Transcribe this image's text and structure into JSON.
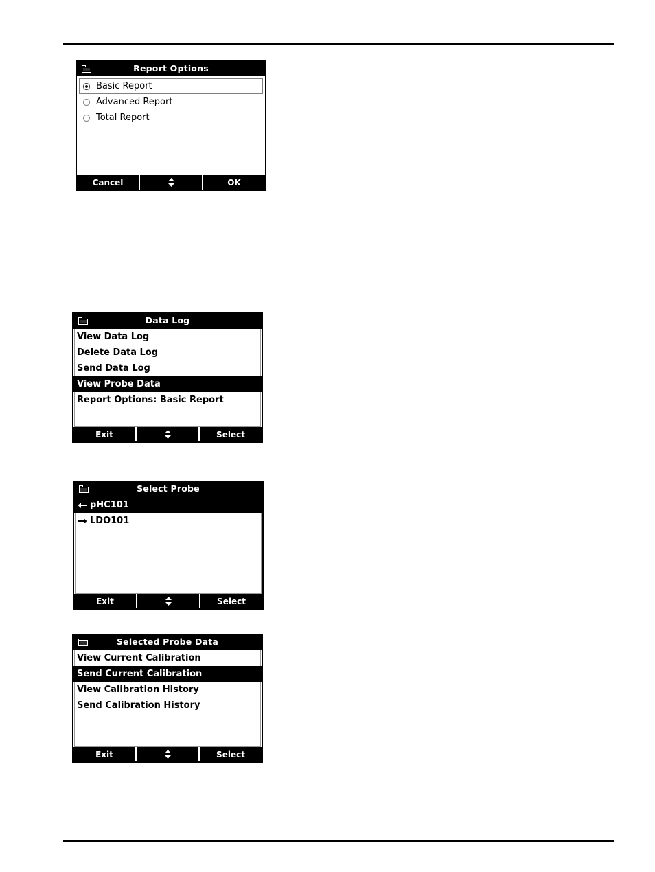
{
  "page": {
    "rules": [
      "header-rule",
      "footer-rule"
    ]
  },
  "screens": [
    {
      "id": "report-options",
      "title": "Report Options",
      "icon": "folder-icon",
      "type": "radio-list",
      "options": [
        {
          "label": "Basic Report",
          "selected": true,
          "focused": true
        },
        {
          "label": "Advanced Report",
          "selected": false,
          "focused": false
        },
        {
          "label": "Total Report",
          "selected": false,
          "focused": false
        }
      ],
      "softkeys": [
        {
          "label": "Cancel",
          "icon": ""
        },
        {
          "label": "",
          "icon": "up-down-arrow-icon"
        },
        {
          "label": "OK",
          "icon": ""
        }
      ]
    },
    {
      "id": "data-log",
      "title": "Data Log",
      "icon": "folder-icon",
      "type": "menu-list",
      "items": [
        {
          "label": "View Data Log",
          "selected": false,
          "arrow": ""
        },
        {
          "label": "Delete Data Log",
          "selected": false,
          "arrow": ""
        },
        {
          "label": "Send Data Log",
          "selected": false,
          "arrow": ""
        },
        {
          "label": "View Probe Data",
          "selected": true,
          "arrow": ""
        },
        {
          "label": "Report Options: Basic Report",
          "selected": false,
          "arrow": ""
        }
      ],
      "softkeys": [
        {
          "label": "Exit",
          "icon": ""
        },
        {
          "label": "",
          "icon": "up-down-arrow-icon"
        },
        {
          "label": "Select",
          "icon": ""
        }
      ]
    },
    {
      "id": "select-probe",
      "title": "Select Probe",
      "icon": "folder-icon",
      "type": "menu-list",
      "items": [
        {
          "label": "pHC101",
          "selected": true,
          "arrow": "arrow-left-icon"
        },
        {
          "label": "LDO101",
          "selected": false,
          "arrow": "arrow-right-icon"
        }
      ],
      "softkeys": [
        {
          "label": "Exit",
          "icon": ""
        },
        {
          "label": "",
          "icon": "up-down-arrow-icon"
        },
        {
          "label": "Select",
          "icon": ""
        }
      ]
    },
    {
      "id": "selected-probe-data",
      "title": "Selected Probe Data",
      "icon": "folder-icon",
      "type": "menu-list",
      "items": [
        {
          "label": "View Current Calibration",
          "selected": false,
          "arrow": ""
        },
        {
          "label": "Send Current Calibration",
          "selected": true,
          "arrow": ""
        },
        {
          "label": "View Calibration History",
          "selected": false,
          "arrow": ""
        },
        {
          "label": "Send Calibration History",
          "selected": false,
          "arrow": ""
        }
      ],
      "softkeys": [
        {
          "label": "Exit",
          "icon": ""
        },
        {
          "label": "",
          "icon": "up-down-arrow-icon"
        },
        {
          "label": "Select",
          "icon": ""
        }
      ]
    }
  ],
  "colors": {
    "lcd_background": "#ffffff",
    "lcd_foreground": "#000000",
    "highlight_background": "#000000",
    "highlight_foreground": "#ffffff",
    "page_background": "#ffffff"
  }
}
